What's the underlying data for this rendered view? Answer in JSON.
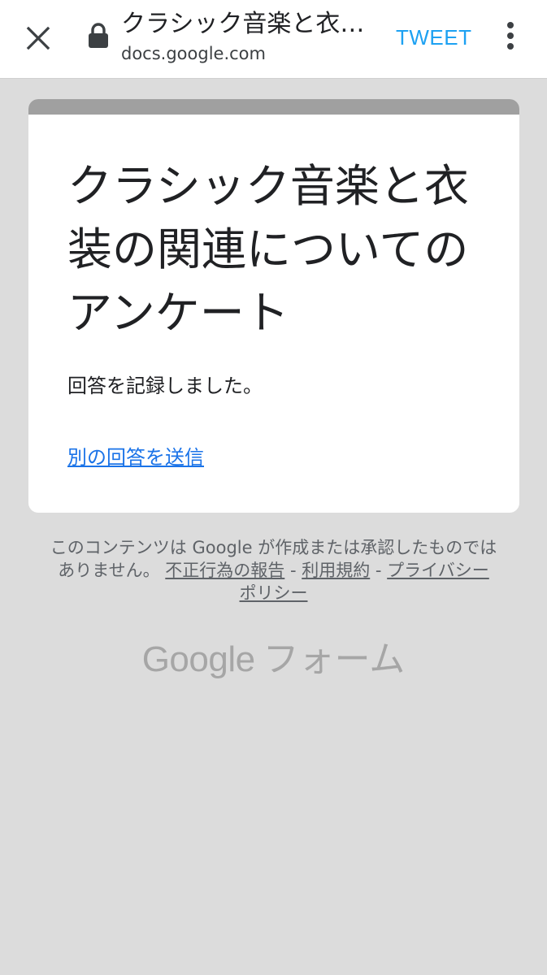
{
  "browser": {
    "page_title": "クラシック音楽と衣…",
    "domain": "docs.google.com",
    "tweet_label": "TWEET",
    "close_icon": "close-icon",
    "lock_icon": "lock-icon",
    "menu_icon": "more-vert-icon",
    "tweet_color": "#1da1f2"
  },
  "form": {
    "accent_color": "#a0a0a0",
    "title": "クラシック音楽と衣装の関連についてのアンケート",
    "confirmation": "回答を記録しました。",
    "submit_another_label": "別の回答を送信",
    "link_color": "#1a73e8"
  },
  "footer": {
    "disclaimer_text": "このコンテンツは Google が作成または承認したものではありません。",
    "links": [
      {
        "label": "不正行為の報告"
      },
      {
        "label": "利用規約"
      },
      {
        "label": "プライバシー ポリシー"
      }
    ],
    "separator": " - ",
    "brand_google": "Google",
    "brand_product": "フォーム"
  }
}
